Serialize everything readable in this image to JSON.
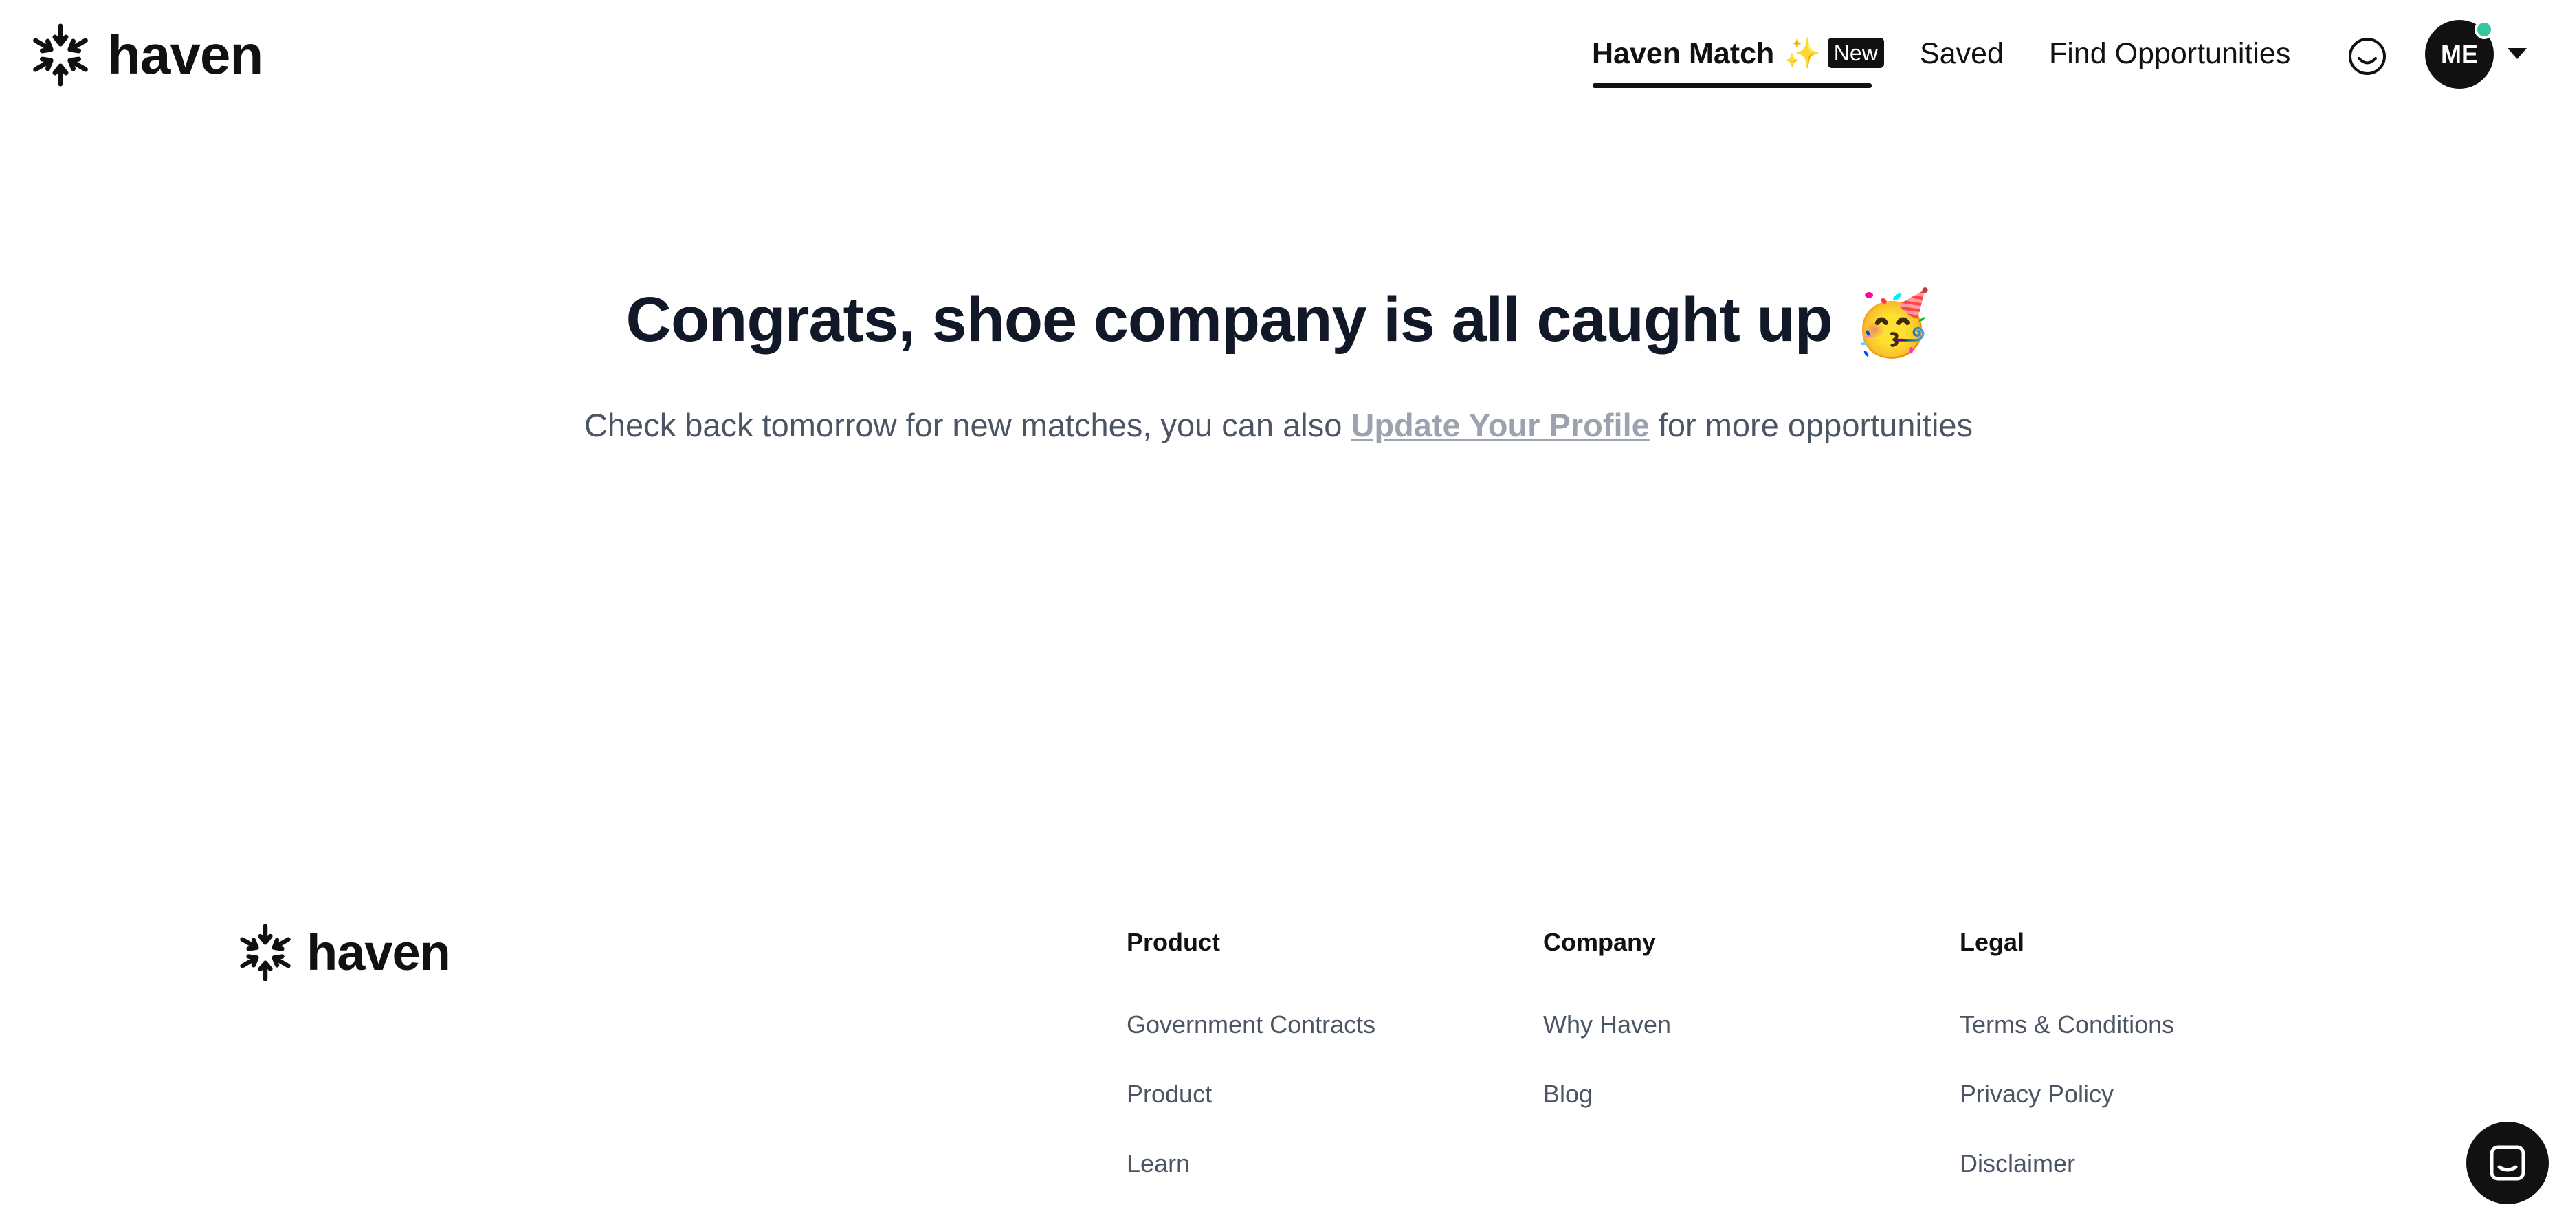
{
  "header": {
    "logo_text": "haven",
    "nav": {
      "match_label": "Haven Match",
      "match_sparkle": "✨",
      "match_badge": "New",
      "saved_label": "Saved",
      "find_label": "Find Opportunities"
    },
    "avatar_initials": "ME"
  },
  "hero": {
    "title": "Congrats, shoe company is all caught up",
    "title_emoji": "🥳",
    "subtitle_before": "Check back tomorrow for new matches, you can also ",
    "subtitle_link": "Update Your Profile",
    "subtitle_after": " for more opportunities"
  },
  "footer": {
    "logo_text": "haven",
    "columns": [
      {
        "heading": "Product",
        "links": [
          "Government Contracts",
          "Product",
          "Learn"
        ]
      },
      {
        "heading": "Company",
        "links": [
          "Why Haven",
          "Blog"
        ]
      },
      {
        "heading": "Legal",
        "links": [
          "Terms & Conditions",
          "Privacy Policy",
          "Disclaimer"
        ]
      }
    ]
  },
  "colors": {
    "primary": "#111111",
    "heading": "#111827",
    "body_text": "#4b5563",
    "muted_link": "#9ca3af",
    "status_dot": "#34c7a0"
  },
  "icons": {
    "logo": "starburst-icon",
    "feedback": "smiley-icon",
    "menu": "caret-down-icon",
    "chat": "chat-icon"
  }
}
